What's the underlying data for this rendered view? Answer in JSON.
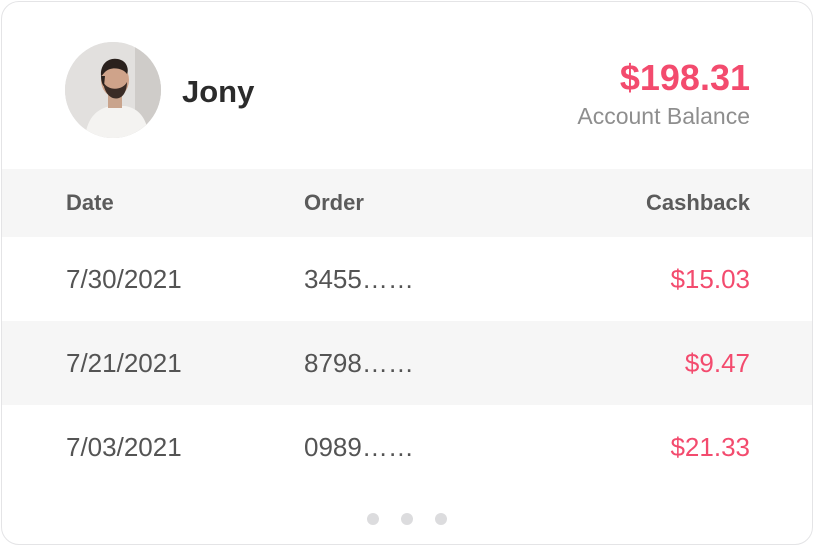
{
  "user": {
    "name": "Jony",
    "avatar_icon": "profile-photo"
  },
  "account": {
    "balance": "$198.31",
    "balance_label": "Account Balance"
  },
  "table": {
    "headers": {
      "date": "Date",
      "order": "Order",
      "cashback": "Cashback"
    },
    "rows": [
      {
        "date": "7/30/2021",
        "order": "3455……",
        "cashback": "$15.03"
      },
      {
        "date": "7/21/2021",
        "order": "8798……",
        "cashback": "$9.47"
      },
      {
        "date": "7/03/2021",
        "order": "0989……",
        "cashback": "$21.33"
      }
    ]
  },
  "pagination": {
    "dot_count": 3
  },
  "colors": {
    "accent": "#f34b6e",
    "header_bg": "#f6f6f6",
    "text_dark": "#2b2b2b",
    "text_muted": "#8e8e8e"
  }
}
